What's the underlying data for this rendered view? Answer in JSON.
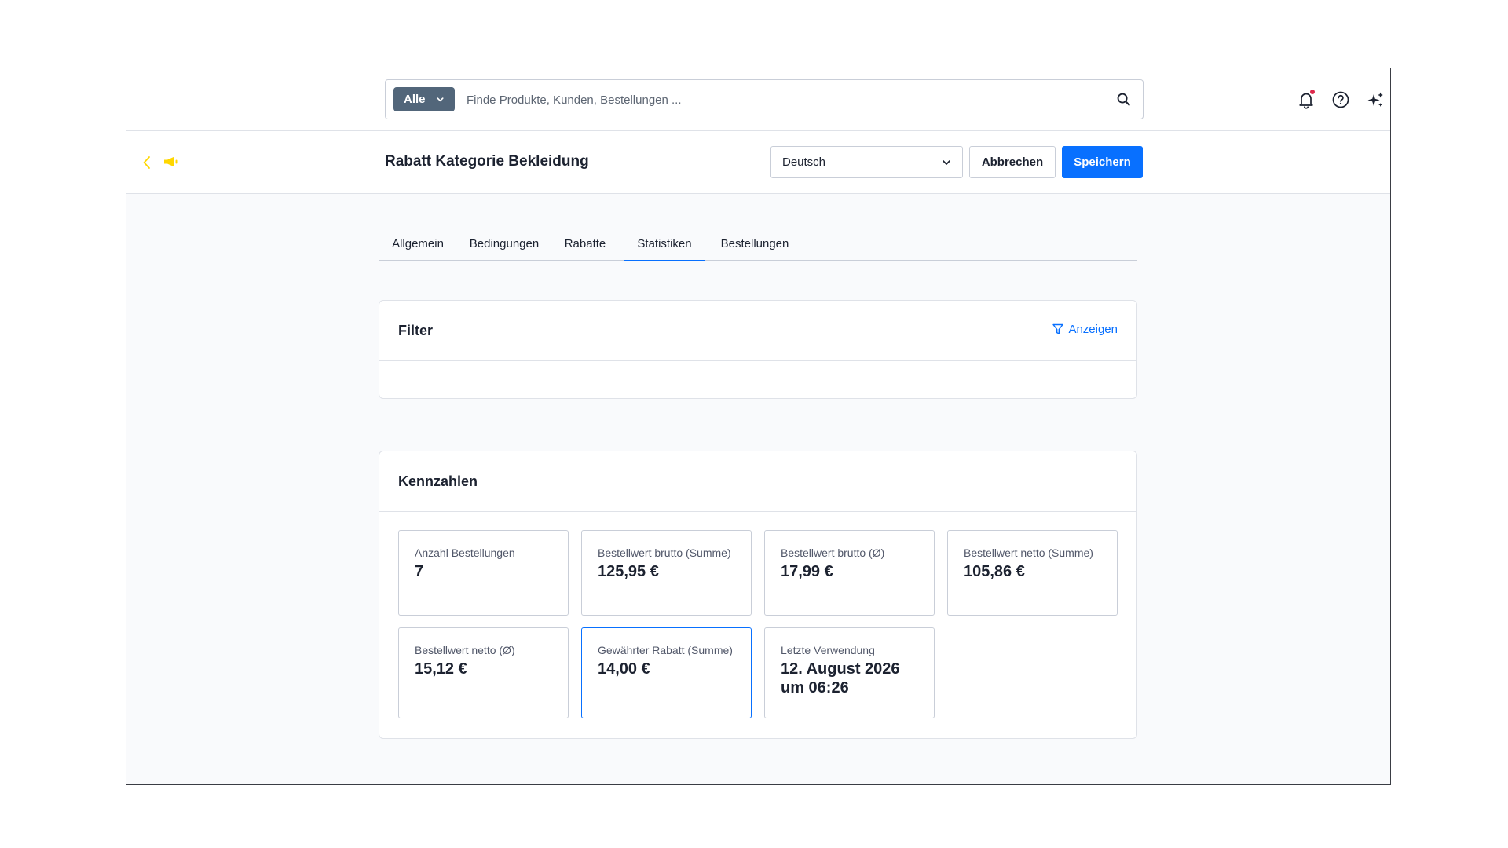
{
  "search": {
    "scope_label": "Alle",
    "placeholder": "Finde Produkte, Kunden, Bestellungen ...",
    "value": ""
  },
  "header": {
    "title": "Rabatt Kategorie Bekleidung",
    "language": "Deutsch",
    "cancel_label": "Abbrechen",
    "save_label": "Speichern"
  },
  "tabs": [
    {
      "label": "Allgemein",
      "active": false
    },
    {
      "label": "Bedingungen",
      "active": false
    },
    {
      "label": "Rabatte",
      "active": false
    },
    {
      "label": "Statistiken",
      "active": true
    },
    {
      "label": "Bestellungen",
      "active": false
    }
  ],
  "filter": {
    "title": "Filter",
    "toggle_label": "Anzeigen"
  },
  "kpis": {
    "title": "Kennzahlen",
    "items": [
      {
        "label": "Anzahl Bestellungen",
        "value": "7"
      },
      {
        "label": "Bestellwert brutto (Summe)",
        "value": "125,95 €"
      },
      {
        "label": "Bestellwert brutto (Ø)",
        "value": "17,99 €"
      },
      {
        "label": "Bestellwert netto (Summe)",
        "value": "105,86 €"
      },
      {
        "label": "Bestellwert netto (Ø)",
        "value": "15,12 €"
      },
      {
        "label": "Gewährter Rabatt (Summe)",
        "value": "14,00 €"
      },
      {
        "label": "Letzte Verwendung",
        "value": "12. August 2026 um 06:26"
      }
    ]
  },
  "colors": {
    "primary": "#0870ff",
    "scope_button": "#52667a",
    "module_icon": "#ffd700",
    "notification_dot": "#de294c"
  },
  "icons": [
    "search-icon",
    "chevron-down-icon",
    "bell-icon",
    "help-icon",
    "sparkle-icon",
    "back-arrow-icon",
    "megaphone-icon",
    "funnel-icon"
  ]
}
